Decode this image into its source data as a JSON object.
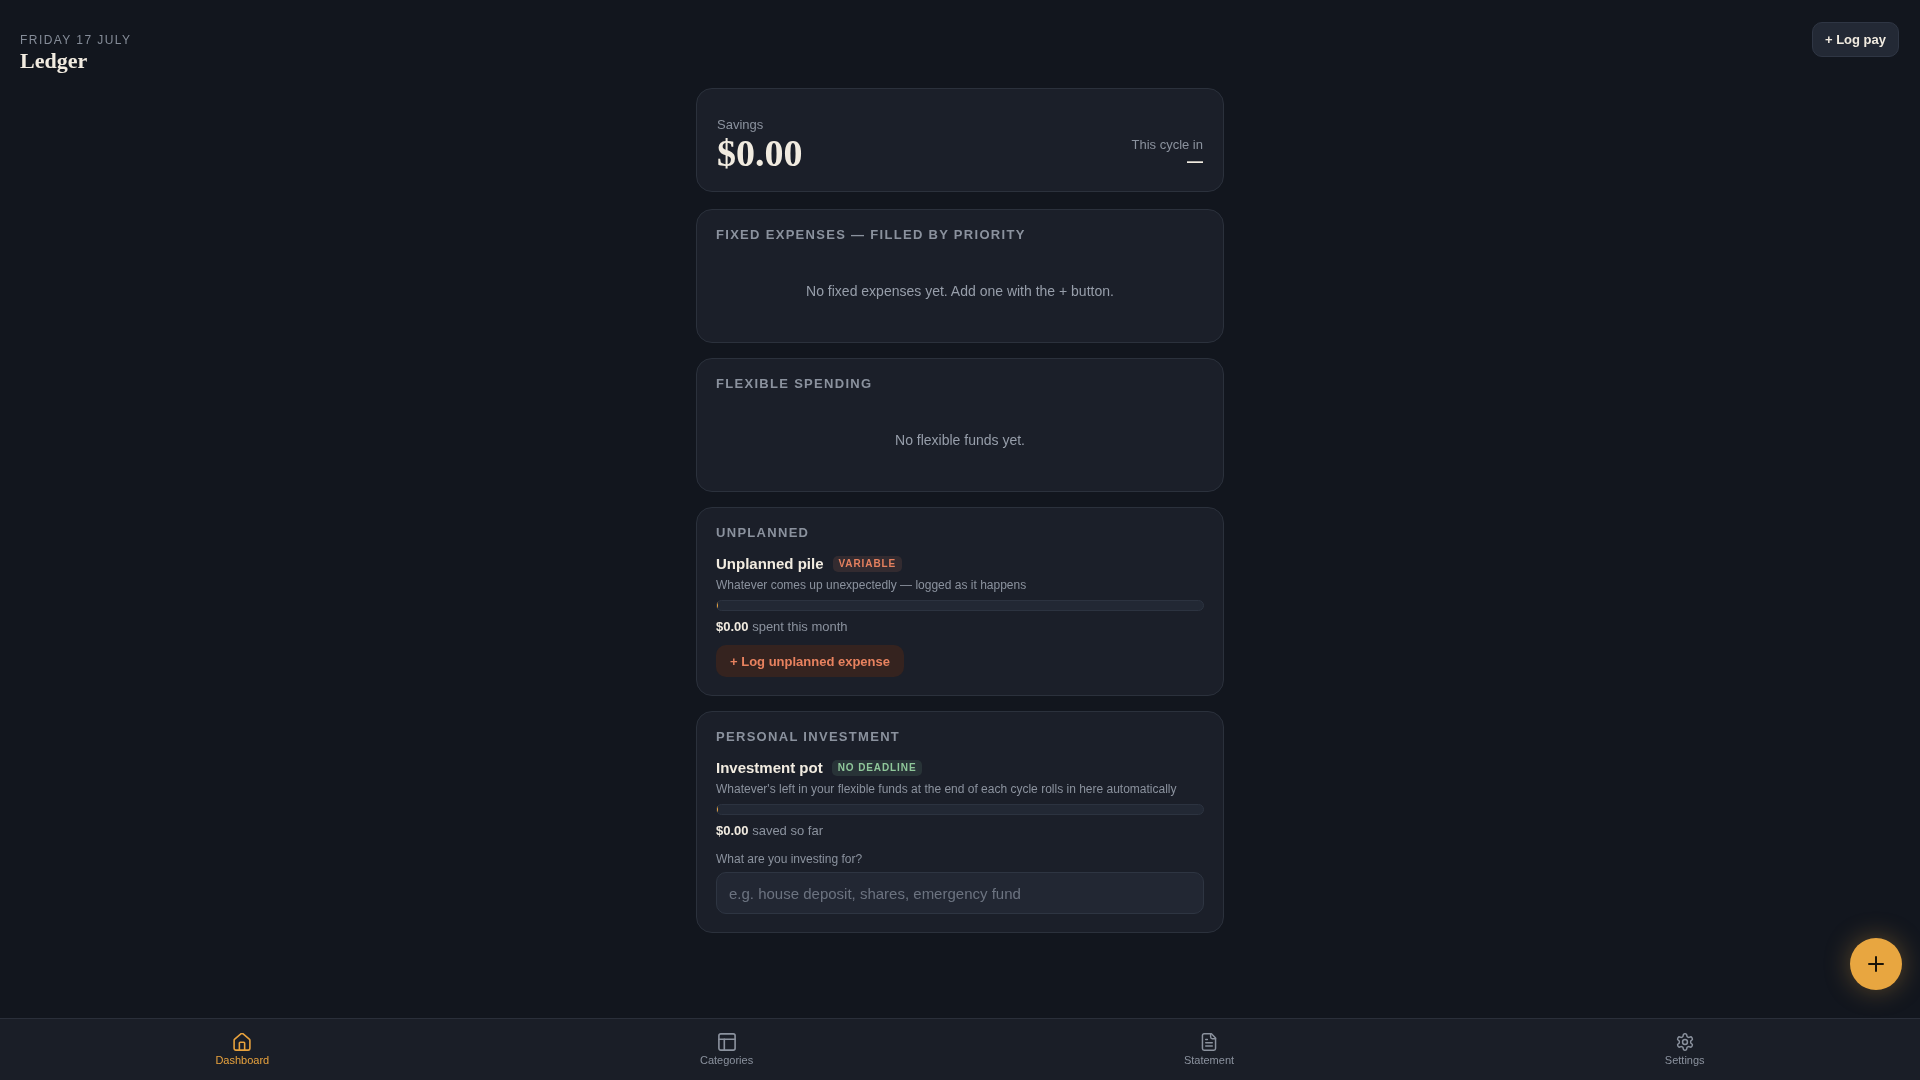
{
  "header": {
    "date": "FRIDAY 17 JULY",
    "title": "Ledger"
  },
  "log_pay_button": "+ Log pay",
  "savings_card": {
    "label": "Savings",
    "amount": "$0.00",
    "cycle_label": "This cycle in",
    "cycle_value": "—"
  },
  "sections": [
    {
      "kind": "empty",
      "title": "FIXED EXPENSES — FILLED BY PRIORITY",
      "empty_text": "No fixed expenses yet. Add one with the + button."
    },
    {
      "kind": "empty",
      "title": "FLEXIBLE SPENDING",
      "empty_text": "No flexible funds yet."
    },
    {
      "kind": "pot",
      "title": "UNPLANNED",
      "name": "Unplanned pile",
      "badge": {
        "text": "VARIABLE",
        "color": "#e5805f"
      },
      "description": "Whatever comes up unexpectedly — logged as it happens",
      "level": 0,
      "amount_text": "**$0.00** spent this month",
      "action_button": "+ Log unplanned expense"
    },
    {
      "kind": "pot",
      "title": "PERSONAL INVESTMENT",
      "name": "Investment pot",
      "badge": {
        "text": "NO DEADLINE",
        "color": "#8fc79a"
      },
      "description": "Whatever's left in your flexible funds at the end of each cycle rolls in here automatically",
      "level": 0,
      "amount_text": "**$0.00** saved so far",
      "field": {
        "label": "What are you investing for?",
        "placeholder": "e.g. house deposit, shares, emergency fund"
      }
    }
  ],
  "nav": [
    {
      "label": "Dashboard",
      "selected": true
    },
    {
      "label": "Categories",
      "selected": false
    },
    {
      "label": "Statement",
      "selected": false
    },
    {
      "label": "Settings",
      "selected": false
    }
  ]
}
